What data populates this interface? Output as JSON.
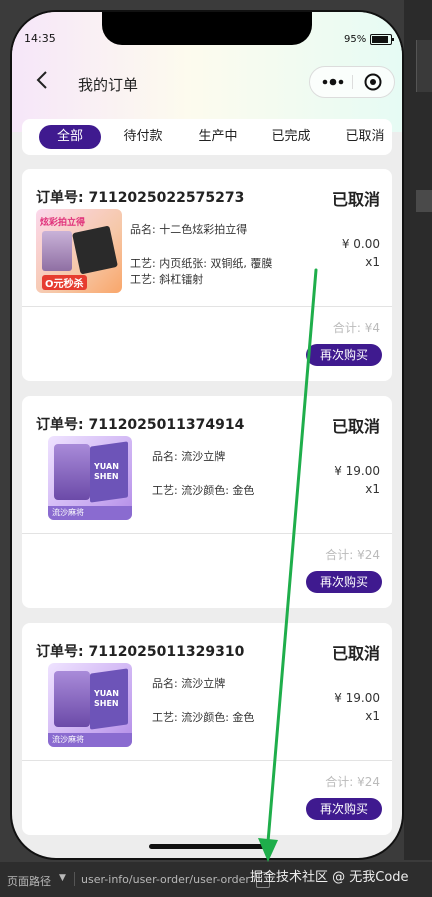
{
  "status_bar": {
    "time": "14:35",
    "battery": "95%"
  },
  "nav": {
    "title": "我的订单"
  },
  "tabs": [
    {
      "label": "全部"
    },
    {
      "label": "待付款"
    },
    {
      "label": "生产中"
    },
    {
      "label": "已完成"
    },
    {
      "label": "已取消"
    }
  ],
  "orders": [
    {
      "order_no": "订单号: 7112025022575273",
      "status": "已取消",
      "line1": "品名: 十二色炫彩拍立得",
      "line2": "工艺: 内页纸张: 双铜纸, 覆膜工艺: 斜杠镭射",
      "price": "¥ 0.00",
      "qty": "x1",
      "total": "合计: ¥4",
      "button": "再次购买",
      "thumb_text": "炫彩拍立得",
      "thumb_badge": "O元秒杀"
    },
    {
      "order_no": "订单号: 7112025011374914",
      "status": "已取消",
      "line1": "品名: 流沙立牌",
      "line2": "工艺: 流沙颜色: 金色",
      "price": "¥ 19.00",
      "qty": "x1",
      "total": "合计: ¥24",
      "button": "再次购买",
      "thumb_text": "YUAN SHEN",
      "thumb_badge": "流沙麻将"
    },
    {
      "order_no": "订单号: 7112025011329310",
      "status": "已取消",
      "line1": "品名: 流沙立牌",
      "line2": "工艺: 流沙颜色: 金色",
      "price": "¥ 19.00",
      "qty": "x1",
      "total": "合计: ¥24",
      "button": "再次购买",
      "thumb_text": "YUAN SHEN",
      "thumb_badge": "流沙麻将"
    }
  ],
  "devtools": {
    "path_label": "页面路径",
    "path_value": "user-info/user-order/user-order",
    "watermark": "掘金技术社区 @ 无我Code"
  },
  "colors": {
    "accent": "#3f1a8f",
    "annotation_arrow": "#1fae4b"
  }
}
